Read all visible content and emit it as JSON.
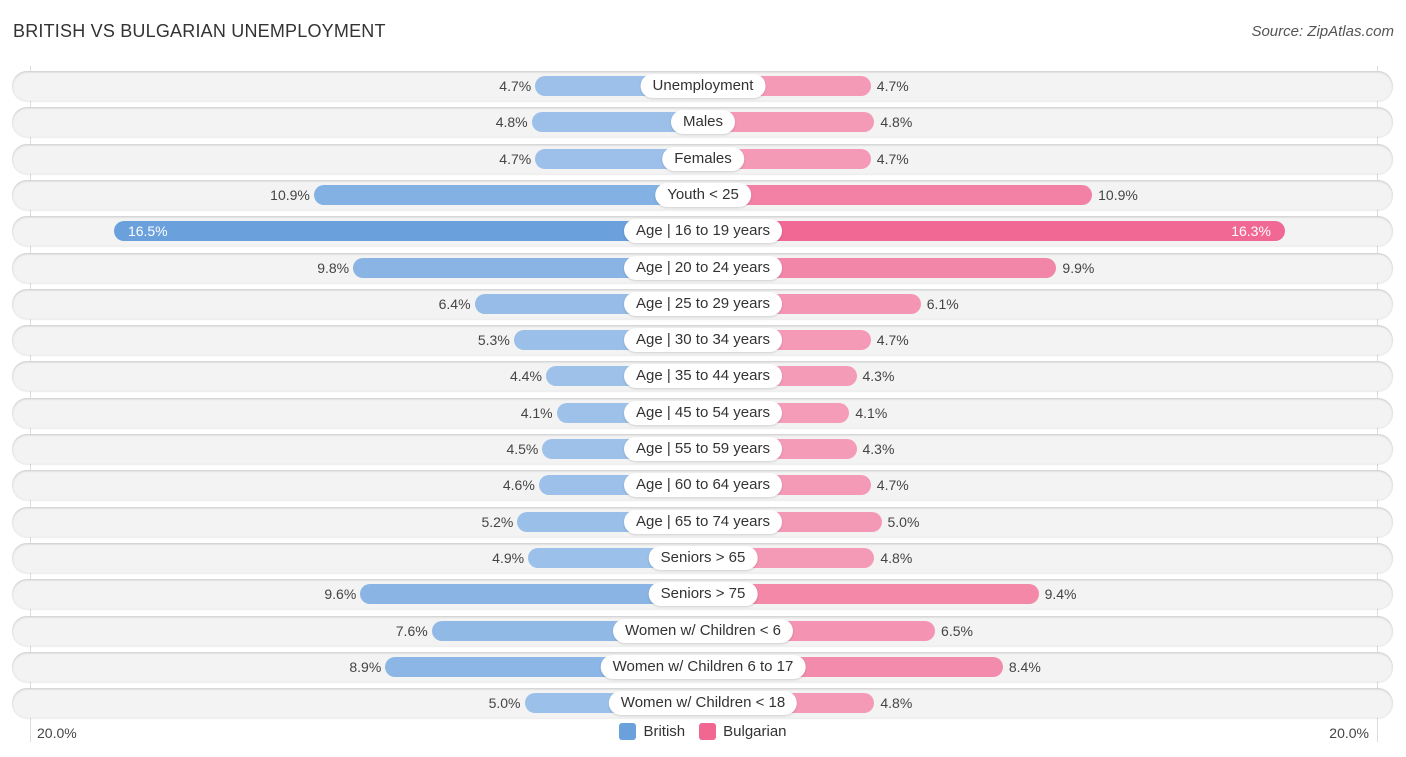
{
  "title": "BRITISH VS BULGARIAN UNEMPLOYMENT",
  "source": "Source: ZipAtlas.com",
  "colors": {
    "british": "#6aa0dc",
    "british_light": "#a8c8ec",
    "bulgarian": "#f06792",
    "bulgarian_light": "#f5a6bf",
    "row_bg": "#f3f3f3"
  },
  "axis": {
    "left_label": "20.0%",
    "right_label": "20.0%"
  },
  "legend": [
    {
      "name": "British",
      "color": "#6aa0dc"
    },
    {
      "name": "Bulgarian",
      "color": "#f06792"
    }
  ],
  "chart_data": {
    "type": "bar",
    "orientation": "horizontal-diverging",
    "title": "BRITISH VS BULGARIAN UNEMPLOYMENT",
    "xlabel": "",
    "ylabel": "",
    "xlim": [
      -20,
      20
    ],
    "legend_position": "bottom-center",
    "categories": [
      "Unemployment",
      "Males",
      "Females",
      "Youth < 25",
      "Age | 16 to 19 years",
      "Age | 20 to 24 years",
      "Age | 25 to 29 years",
      "Age | 30 to 34 years",
      "Age | 35 to 44 years",
      "Age | 45 to 54 years",
      "Age | 55 to 59 years",
      "Age | 60 to 64 years",
      "Age | 65 to 74 years",
      "Seniors > 65",
      "Seniors > 75",
      "Women w/ Children < 6",
      "Women w/ Children 6 to 17",
      "Women w/ Children < 18"
    ],
    "series": [
      {
        "name": "British",
        "values": [
          4.7,
          4.8,
          4.7,
          10.9,
          16.5,
          9.8,
          6.4,
          5.3,
          4.4,
          4.1,
          4.5,
          4.6,
          5.2,
          4.9,
          9.6,
          7.6,
          8.9,
          5.0
        ],
        "labels": [
          "4.7%",
          "4.8%",
          "4.7%",
          "10.9%",
          "16.5%",
          "9.8%",
          "6.4%",
          "5.3%",
          "4.4%",
          "4.1%",
          "4.5%",
          "4.6%",
          "5.2%",
          "4.9%",
          "9.6%",
          "7.6%",
          "8.9%",
          "5.0%"
        ]
      },
      {
        "name": "Bulgarian",
        "values": [
          4.7,
          4.8,
          4.7,
          10.9,
          16.3,
          9.9,
          6.1,
          4.7,
          4.3,
          4.1,
          4.3,
          4.7,
          5.0,
          4.8,
          9.4,
          6.5,
          8.4,
          4.8
        ],
        "labels": [
          "4.7%",
          "4.8%",
          "4.7%",
          "10.9%",
          "16.3%",
          "9.9%",
          "6.1%",
          "4.7%",
          "4.3%",
          "4.1%",
          "4.3%",
          "4.7%",
          "5.0%",
          "4.8%",
          "9.4%",
          "6.5%",
          "8.4%",
          "4.8%"
        ]
      }
    ]
  }
}
